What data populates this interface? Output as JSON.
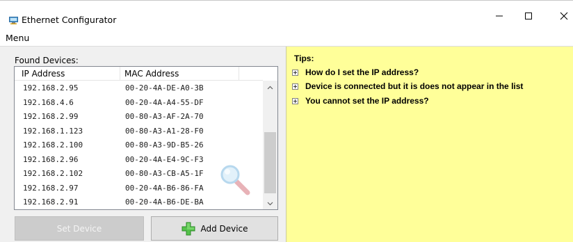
{
  "window": {
    "title": "Ethernet Configurator",
    "icon": "network-app-icon",
    "controls": [
      "minimize-icon",
      "maximize-icon",
      "close-icon"
    ]
  },
  "menu": {
    "items": [
      "Menu"
    ]
  },
  "devices": {
    "label": "Found Devices:",
    "columns": [
      "IP Address",
      "MAC Address"
    ],
    "rows": [
      {
        "ip": "192.168.2.95",
        "mac": "00-20-4A-DE-A0-3B"
      },
      {
        "ip": "192.168.4.6",
        "mac": "00-20-4A-A4-55-DF"
      },
      {
        "ip": "192.168.2.99",
        "mac": "00-80-A3-AF-2A-70"
      },
      {
        "ip": "192.168.1.123",
        "mac": "00-80-A3-A1-28-F0"
      },
      {
        "ip": "192.168.2.100",
        "mac": "00-80-A3-9D-B5-26"
      },
      {
        "ip": "192.168.2.96",
        "mac": "00-20-4A-E4-9C-F3"
      },
      {
        "ip": "192.168.2.102",
        "mac": "00-80-A3-CB-A5-1F"
      },
      {
        "ip": "192.168.2.97",
        "mac": "00-20-4A-B6-86-FA"
      },
      {
        "ip": "192.168.2.91",
        "mac": "00-20-4A-B6-DE-BA"
      }
    ]
  },
  "buttons": {
    "set_device": "Set Device",
    "add_device": "Add Device"
  },
  "tips": {
    "title": "Tips:",
    "items": [
      "How do I set the IP address?",
      "Device is connected but it is does not appear in the list",
      "You cannot set the IP address?"
    ]
  },
  "colors": {
    "tips_background": "#ffff99",
    "add_icon_green": "#3aaa35",
    "disabled_button": "#cccccc"
  }
}
